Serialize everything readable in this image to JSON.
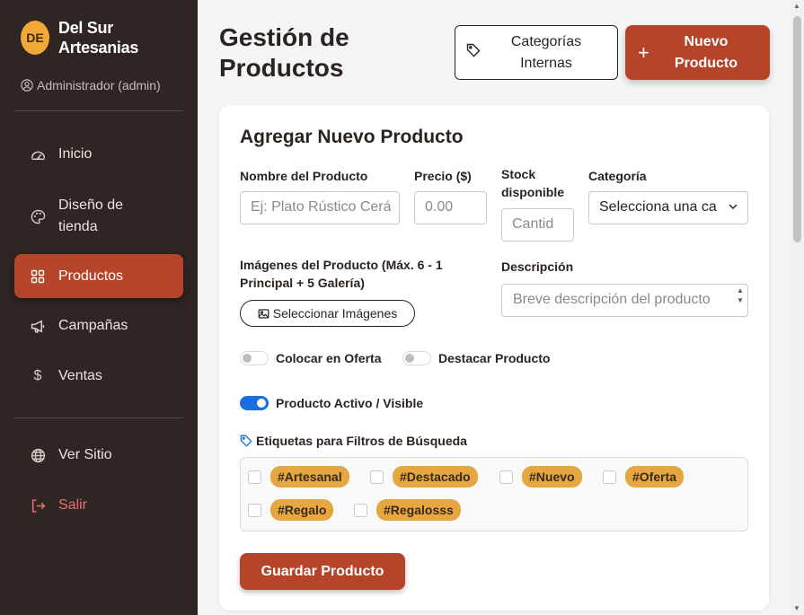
{
  "brand": {
    "logo_text": "DE",
    "name": "Del Sur Artesanias"
  },
  "user": {
    "label": "Administrador (admin)"
  },
  "nav": {
    "items": [
      {
        "label": "Inicio",
        "icon": "dashboard-gauge-icon"
      },
      {
        "label": "Diseño de tienda",
        "icon": "palette-icon"
      },
      {
        "label": "Productos",
        "icon": "grid-icon",
        "active": true
      },
      {
        "label": "Campañas",
        "icon": "megaphone-icon"
      },
      {
        "label": "Ventas",
        "icon": "dollar-icon"
      }
    ],
    "view_site": "Ver Sitio",
    "logout": "Salir"
  },
  "header": {
    "title": "Gestión de Productos",
    "categories_button": "Categorías Internas",
    "new_product_button": "Nuevo Producto",
    "new_product_icon": "+"
  },
  "form": {
    "title": "Agregar Nuevo Producto",
    "name_label": "Nombre del Producto",
    "name_placeholder": "Ej: Plato Rústico Cerá",
    "price_label": "Precio ($)",
    "price_placeholder": "0.00",
    "stock_label": "Stock disponible",
    "stock_placeholder": "Cantid",
    "category_label": "Categoría",
    "category_value": "Selecciona una ca",
    "images_label": "Imágenes del Producto (Máx. 6 - 1 Principal + 5 Galería)",
    "images_button": "Seleccionar Imágenes",
    "description_label": "Descripción",
    "description_placeholder": "Breve descripción del producto",
    "offer_toggle": {
      "label": "Colocar en Oferta",
      "on": false
    },
    "featured_toggle": {
      "label": "Destacar Producto",
      "on": false
    },
    "active_toggle": {
      "label": "Producto Activo / Visible",
      "on": true
    },
    "tags_label": "Etiquetas para Filtros de Búsqueda",
    "tags": [
      "#Artesanal",
      "#Destacado",
      "#Nuevo",
      "#Oferta",
      "#Regalo",
      "#Regalosss"
    ],
    "save_button": "Guardar Producto"
  },
  "colors": {
    "accent": "#b5442a",
    "sidebar": "#2f2522",
    "tag": "#e6a640",
    "toggle_on": "#1a6fe0"
  }
}
